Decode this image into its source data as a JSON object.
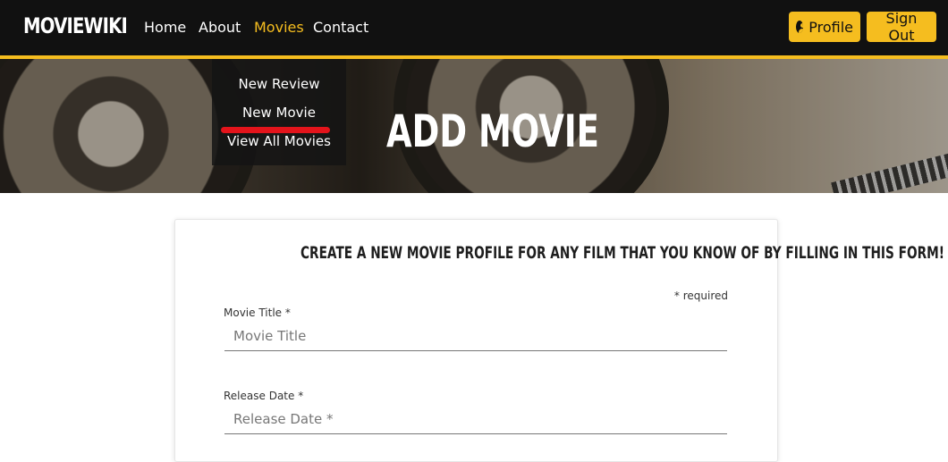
{
  "nav": {
    "brand": "MOVIEWIKI",
    "links": [
      "Home",
      "About",
      "Movies",
      "Contact"
    ],
    "active": "Movies",
    "profile_label": "Profile",
    "signout_label": "Sign Out"
  },
  "dropdown": {
    "items": [
      "New Review",
      "New Movie",
      "View All Movies"
    ]
  },
  "hero": {
    "title": "ADD MOVIE"
  },
  "form": {
    "heading": "CREATE A NEW MOVIE PROFILE FOR ANY FILM THAT YOU KNOW OF BY FILLING IN THIS FORM!",
    "required_note": "* required",
    "fields": [
      {
        "label": "Movie Title *",
        "placeholder": "Movie Title"
      },
      {
        "label": "Release Date *",
        "placeholder": "Release Date *"
      }
    ]
  },
  "colors": {
    "navbar_bg": "#111111",
    "accent": "#f5bd1f",
    "annotation": "#e3141b"
  },
  "icons": {
    "profile": "user-circle-icon"
  }
}
